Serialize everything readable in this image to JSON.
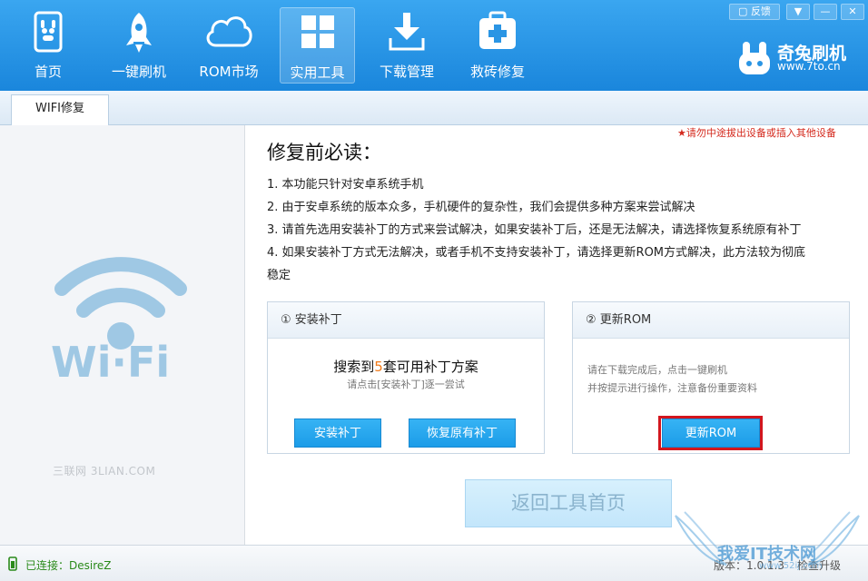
{
  "toolbar": {
    "items": [
      {
        "label": "首页",
        "icon": "phone-icon"
      },
      {
        "label": "一键刷机",
        "icon": "rocket-icon"
      },
      {
        "label": "ROM市场",
        "icon": "cloud-icon"
      },
      {
        "label": "实用工具",
        "icon": "grid-icon"
      },
      {
        "label": "下载管理",
        "icon": "download-icon"
      },
      {
        "label": "救砖修复",
        "icon": "medkit-icon"
      }
    ],
    "active_index": 3,
    "feedback_label": "反馈"
  },
  "brand": {
    "title": "奇兔刷机",
    "url": "www.7to.cn"
  },
  "tabs": [
    {
      "label": "WIFI修复"
    }
  ],
  "left_panel": {
    "logo_text": "Wi·Fi",
    "watermark": "三联网 3LIAN.COM"
  },
  "main": {
    "warning": "★请勿中途拔出设备或插入其他设备",
    "title": "修复前必读：",
    "rules": [
      "1. 本功能只针对安卓系统手机",
      "2. 由于安卓系统的版本众多，手机硬件的复杂性，我们会提供多种方案来尝试解决",
      "3. 请首先选用安装补丁的方式来尝试解决，如果安装补丁后，还是无法解决，请选择恢复系统原有补丁",
      "4. 如果安装补丁方式无法解决，或者手机不支持安装补丁，请选择更新ROM方式解决，此方法较为彻底",
      "稳定"
    ],
    "patch_card": {
      "header": "① 安装补丁",
      "search_prefix": "搜索到",
      "search_count": "5",
      "search_suffix": "套可用补丁方案",
      "hint": "请点击[安装补丁]逐一尝试",
      "install_button": "安装补丁",
      "restore_button": "恢复原有补丁"
    },
    "rom_card": {
      "header": "② 更新ROM",
      "line1": "请在下载完成后，点击一键刷机",
      "line2": "并按提示进行操作，注意备份重要资料",
      "update_button": "更新ROM"
    },
    "back_button": "返回工具首页"
  },
  "status": {
    "connection": "已连接：DesireZ",
    "version": "版本：1.0.1.3",
    "update_label": "检查升级"
  },
  "watermark_right": {
    "text": "我爱IT技术网",
    "sub": "www.52ij.com"
  },
  "colors": {
    "accent": "#1a86dc",
    "button": "#1c9ce8",
    "highlight": "#d2161e",
    "count": "#f27b1a"
  }
}
